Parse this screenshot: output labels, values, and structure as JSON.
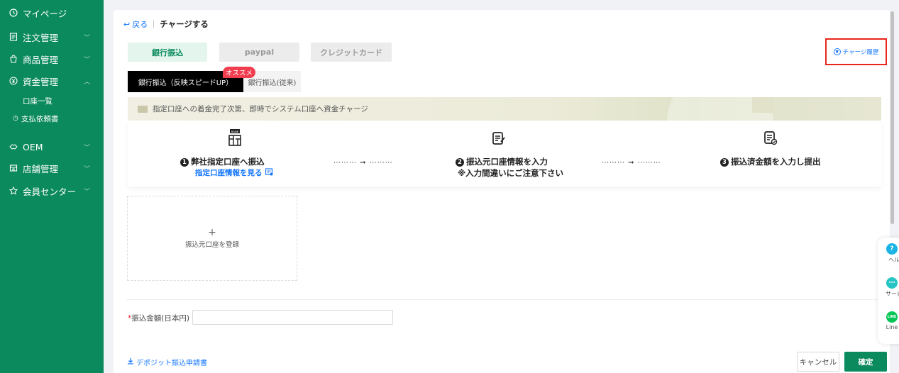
{
  "sidebar": {
    "items": [
      {
        "label": "マイページ",
        "icon": "clock-icon"
      },
      {
        "label": "注文管理",
        "icon": "document-icon"
      },
      {
        "label": "商品管理",
        "icon": "bag-icon"
      },
      {
        "label": "資金管理",
        "icon": "yen-circle-icon"
      },
      {
        "label": "OEM",
        "icon": "handshake-icon"
      },
      {
        "label": "店舗管理",
        "icon": "store-icon"
      },
      {
        "label": "会員センター",
        "icon": "star-icon"
      }
    ],
    "subitems": [
      {
        "label": "口座一覧"
      },
      {
        "label": "支払依頼書",
        "icon": "clock-icon"
      }
    ]
  },
  "header": {
    "back_label": "戻る",
    "title": "チャージする"
  },
  "payment_tabs": [
    "銀行振込",
    "paypal",
    "クレジットカード"
  ],
  "history_link": "チャージ履歴",
  "sub_tabs": {
    "fast": "銀行振込（反映スピードUP）",
    "normal": "銀行振込(従来)",
    "badge": "オススメ"
  },
  "notice": "指定口座への着金完了次第、即時でシステム口座へ資金チャージ",
  "steps": [
    {
      "num": "1",
      "title": "弊社指定口座へ振込",
      "link": "指定口座情報を見る"
    },
    {
      "num": "2",
      "title": "振込元口座情報を入力",
      "sub": "※入力間違いにご注意下さい"
    },
    {
      "num": "3",
      "title": "振込済金額を入力し提出"
    }
  ],
  "add_account": {
    "plus": "+",
    "label": "振込元口座を登録"
  },
  "amount": {
    "required_mark": "*",
    "label": "振込金額(日本円)",
    "value": ""
  },
  "download_link": "デポジット振込申請書",
  "buttons": {
    "cancel": "キャンセル",
    "confirm": "確定"
  },
  "float_panel": [
    {
      "label": "ヘルプ",
      "icon": "help-icon"
    },
    {
      "label": "サービス",
      "icon": "chat-icon"
    },
    {
      "label": "Line",
      "icon": "line-icon",
      "badge": "LINE"
    }
  ],
  "colors": {
    "brand": "#0b8a5e",
    "accent_blue": "#1677ff",
    "highlight_red": "#e8261c"
  }
}
